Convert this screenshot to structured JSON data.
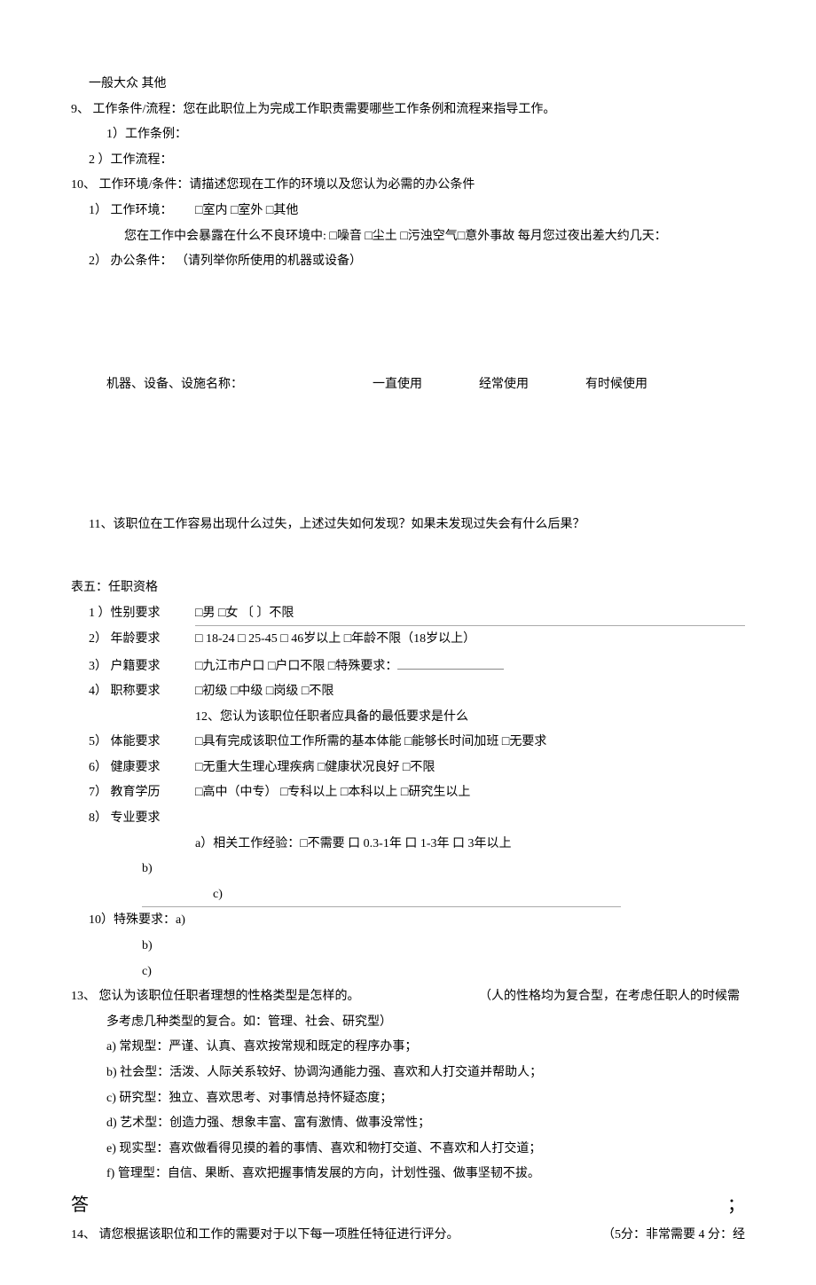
{
  "header": {
    "line1": "一般大众 其他"
  },
  "q9": {
    "title": "9、  工作条件/流程：您在此职位上为完成工作职责需要哪些工作条例和流程来指导工作。",
    "a": "1）工作条例：",
    "b": "2 ）工作流程："
  },
  "q10": {
    "title": "10、 工作环境/条件：请描述您现在工作的环境以及您认为必需的办公条件",
    "env_label": "1） 工作环境：",
    "env_opts": "□室内  □室外  □其他",
    "env_exposure": "您在工作中会暴露在什么不良环境中: □噪音  □尘土  □污浊空气□意外事故  每月您过夜出差大约几天：",
    "office": "2） 办公条件： （请列举你所使用的机器或设备）",
    "usage_header": {
      "name": "机器、设备、设施名称：",
      "c1": "一直使用",
      "c2": "经常使用",
      "c3": "有时候使用"
    }
  },
  "q11": "11、该职位在工作容易出现什么过失，上述过失如何发现？如果未发现过失会有什么后果？",
  "t5": {
    "title": "表五：任职资格",
    "r1": {
      "label": "1 ）性别要求",
      "opts": "□男       □女       〔 〕不限"
    },
    "r2": {
      "label": "2） 年龄要求",
      "opts": "□ 18-24     □ 25-45     □ 46岁以上      □年龄不限（18岁以上）"
    },
    "r3": {
      "label": "3） 户籍要求",
      "opts": "□九江市户口         □户口不限      □特殊要求："
    },
    "r4": {
      "label": "4） 职称要求",
      "opts": "□初级       □中级        □岗级        □不限"
    },
    "q12": "12、您认为该职位任职者应具备的最低要求是什么",
    "r5": {
      "label": "5） 体能要求",
      "opts": "□具有完成该职位工作所需的基本体能           □能够长时间加班       □无要求"
    },
    "r6": {
      "label": "6） 健康要求",
      "opts": "□无重大生理心理疾病          □健康状况良好           □不限"
    },
    "r7": {
      "label": "7） 教育学历",
      "opts": "□高中（中专）      □专科以上        □本科以上      □研究生以上"
    },
    "r8": {
      "label": "8） 专业要求"
    },
    "r9": {
      "a": "a）相关工作经验：□不需要          口 0.3-1年  口 1-3年  口 3年以上",
      "b": "b)",
      "c": "c)"
    },
    "r10": {
      "a": "10）特殊要求：a)",
      "b": "b)",
      "c": "c)"
    }
  },
  "q13": {
    "title_a": "13、 您认为该职位任职者理想的性格类型是怎样的。",
    "title_b": "（人的性格均为复合型，在考虑任职人的时候需",
    "title_cont": "多考虑几种类型的复合。如：管理、社会、研究型）",
    "a": "a)   常规型：严谨、认真、喜欢按常规和既定的程序办事；",
    "b": "b)   社会型：活泼、人际关系较好、协调沟通能力强、喜欢和人打交道并帮助人；",
    "c": "c)   研究型：独立、喜欢思考、对事情总持怀疑态度；",
    "d": "d)   艺术型：创造力强、想象丰富、富有激情、做事没常性；",
    "e": "e)   现实型：喜欢做看得见摸的着的事情、喜欢和物打交道、不喜欢和人打交道；",
    "f": "f)   管理型：自信、果断、喜欢把握事情发展的方向，计划性强、做事坚韧不拔。"
  },
  "answer": {
    "left": "答",
    "right": "；"
  },
  "q14": {
    "title": "14、 请您根据该职位和工作的需要对于以下每一项胜任特征进行评分。",
    "scale": "（5分：非常需要        4 分：经"
  }
}
